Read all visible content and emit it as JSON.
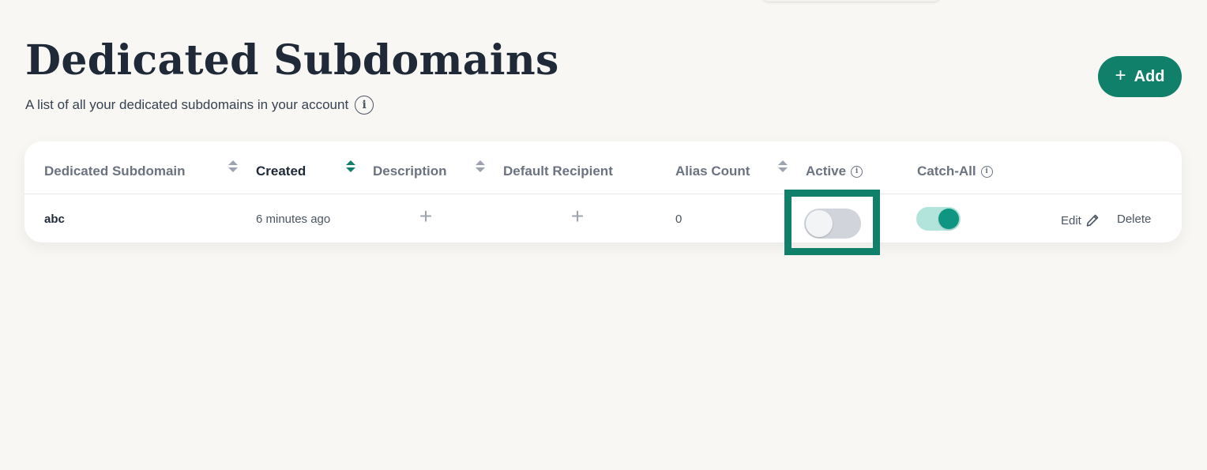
{
  "header": {
    "title": "Dedicated Subdomains",
    "subtitle": "A list of all your dedicated subdomains in your account",
    "add_label": "Add",
    "add_plus": "+"
  },
  "table": {
    "columns": [
      {
        "label": "Dedicated Subdomain",
        "sortable": true,
        "sorted": false
      },
      {
        "label": "Created",
        "sortable": true,
        "sorted": true
      },
      {
        "label": "Description",
        "sortable": true,
        "sorted": false
      },
      {
        "label": "Default Recipient",
        "sortable": false,
        "sorted": false
      },
      {
        "label": "Alias Count",
        "sortable": true,
        "sorted": false
      },
      {
        "label": "Active",
        "sortable": false,
        "info": true
      },
      {
        "label": "Catch-All",
        "sortable": false,
        "info": true
      }
    ],
    "rows": [
      {
        "subdomain": "abc",
        "created": "6 minutes ago",
        "description_add": "+",
        "recipient_add": "+",
        "alias_count": "0",
        "active": false,
        "catch_all": true,
        "edit_label": "Edit",
        "delete_label": "Delete"
      }
    ]
  },
  "icons": {
    "info": "i",
    "info_icon_name": "info-circle-icon",
    "sort_icon_name": "sort-arrows-icon",
    "edit_icon_name": "pencil-icon"
  },
  "colors": {
    "brand": "#11806a",
    "toggle_on_track": "#b2e4dc",
    "toggle_on_knob": "#0f9582",
    "toggle_off_track": "#d1d5db"
  }
}
